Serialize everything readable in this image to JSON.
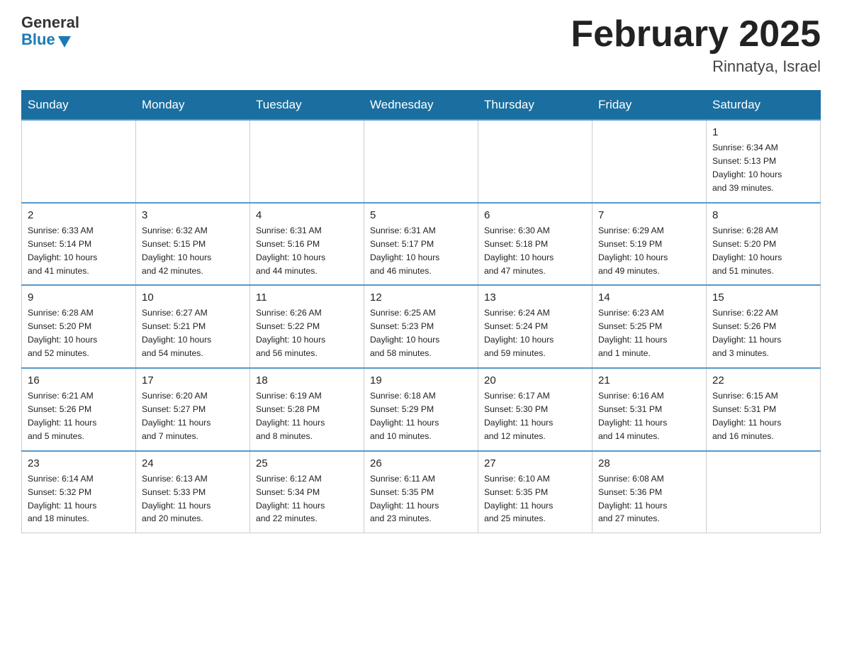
{
  "header": {
    "logo_general": "General",
    "logo_blue": "Blue",
    "title": "February 2025",
    "location": "Rinnatya, Israel"
  },
  "days_of_week": [
    "Sunday",
    "Monday",
    "Tuesday",
    "Wednesday",
    "Thursday",
    "Friday",
    "Saturday"
  ],
  "weeks": [
    [
      {
        "day": "",
        "info": ""
      },
      {
        "day": "",
        "info": ""
      },
      {
        "day": "",
        "info": ""
      },
      {
        "day": "",
        "info": ""
      },
      {
        "day": "",
        "info": ""
      },
      {
        "day": "",
        "info": ""
      },
      {
        "day": "1",
        "info": "Sunrise: 6:34 AM\nSunset: 5:13 PM\nDaylight: 10 hours\nand 39 minutes."
      }
    ],
    [
      {
        "day": "2",
        "info": "Sunrise: 6:33 AM\nSunset: 5:14 PM\nDaylight: 10 hours\nand 41 minutes."
      },
      {
        "day": "3",
        "info": "Sunrise: 6:32 AM\nSunset: 5:15 PM\nDaylight: 10 hours\nand 42 minutes."
      },
      {
        "day": "4",
        "info": "Sunrise: 6:31 AM\nSunset: 5:16 PM\nDaylight: 10 hours\nand 44 minutes."
      },
      {
        "day": "5",
        "info": "Sunrise: 6:31 AM\nSunset: 5:17 PM\nDaylight: 10 hours\nand 46 minutes."
      },
      {
        "day": "6",
        "info": "Sunrise: 6:30 AM\nSunset: 5:18 PM\nDaylight: 10 hours\nand 47 minutes."
      },
      {
        "day": "7",
        "info": "Sunrise: 6:29 AM\nSunset: 5:19 PM\nDaylight: 10 hours\nand 49 minutes."
      },
      {
        "day": "8",
        "info": "Sunrise: 6:28 AM\nSunset: 5:20 PM\nDaylight: 10 hours\nand 51 minutes."
      }
    ],
    [
      {
        "day": "9",
        "info": "Sunrise: 6:28 AM\nSunset: 5:20 PM\nDaylight: 10 hours\nand 52 minutes."
      },
      {
        "day": "10",
        "info": "Sunrise: 6:27 AM\nSunset: 5:21 PM\nDaylight: 10 hours\nand 54 minutes."
      },
      {
        "day": "11",
        "info": "Sunrise: 6:26 AM\nSunset: 5:22 PM\nDaylight: 10 hours\nand 56 minutes."
      },
      {
        "day": "12",
        "info": "Sunrise: 6:25 AM\nSunset: 5:23 PM\nDaylight: 10 hours\nand 58 minutes."
      },
      {
        "day": "13",
        "info": "Sunrise: 6:24 AM\nSunset: 5:24 PM\nDaylight: 10 hours\nand 59 minutes."
      },
      {
        "day": "14",
        "info": "Sunrise: 6:23 AM\nSunset: 5:25 PM\nDaylight: 11 hours\nand 1 minute."
      },
      {
        "day": "15",
        "info": "Sunrise: 6:22 AM\nSunset: 5:26 PM\nDaylight: 11 hours\nand 3 minutes."
      }
    ],
    [
      {
        "day": "16",
        "info": "Sunrise: 6:21 AM\nSunset: 5:26 PM\nDaylight: 11 hours\nand 5 minutes."
      },
      {
        "day": "17",
        "info": "Sunrise: 6:20 AM\nSunset: 5:27 PM\nDaylight: 11 hours\nand 7 minutes."
      },
      {
        "day": "18",
        "info": "Sunrise: 6:19 AM\nSunset: 5:28 PM\nDaylight: 11 hours\nand 8 minutes."
      },
      {
        "day": "19",
        "info": "Sunrise: 6:18 AM\nSunset: 5:29 PM\nDaylight: 11 hours\nand 10 minutes."
      },
      {
        "day": "20",
        "info": "Sunrise: 6:17 AM\nSunset: 5:30 PM\nDaylight: 11 hours\nand 12 minutes."
      },
      {
        "day": "21",
        "info": "Sunrise: 6:16 AM\nSunset: 5:31 PM\nDaylight: 11 hours\nand 14 minutes."
      },
      {
        "day": "22",
        "info": "Sunrise: 6:15 AM\nSunset: 5:31 PM\nDaylight: 11 hours\nand 16 minutes."
      }
    ],
    [
      {
        "day": "23",
        "info": "Sunrise: 6:14 AM\nSunset: 5:32 PM\nDaylight: 11 hours\nand 18 minutes."
      },
      {
        "day": "24",
        "info": "Sunrise: 6:13 AM\nSunset: 5:33 PM\nDaylight: 11 hours\nand 20 minutes."
      },
      {
        "day": "25",
        "info": "Sunrise: 6:12 AM\nSunset: 5:34 PM\nDaylight: 11 hours\nand 22 minutes."
      },
      {
        "day": "26",
        "info": "Sunrise: 6:11 AM\nSunset: 5:35 PM\nDaylight: 11 hours\nand 23 minutes."
      },
      {
        "day": "27",
        "info": "Sunrise: 6:10 AM\nSunset: 5:35 PM\nDaylight: 11 hours\nand 25 minutes."
      },
      {
        "day": "28",
        "info": "Sunrise: 6:08 AM\nSunset: 5:36 PM\nDaylight: 11 hours\nand 27 minutes."
      },
      {
        "day": "",
        "info": ""
      }
    ]
  ]
}
